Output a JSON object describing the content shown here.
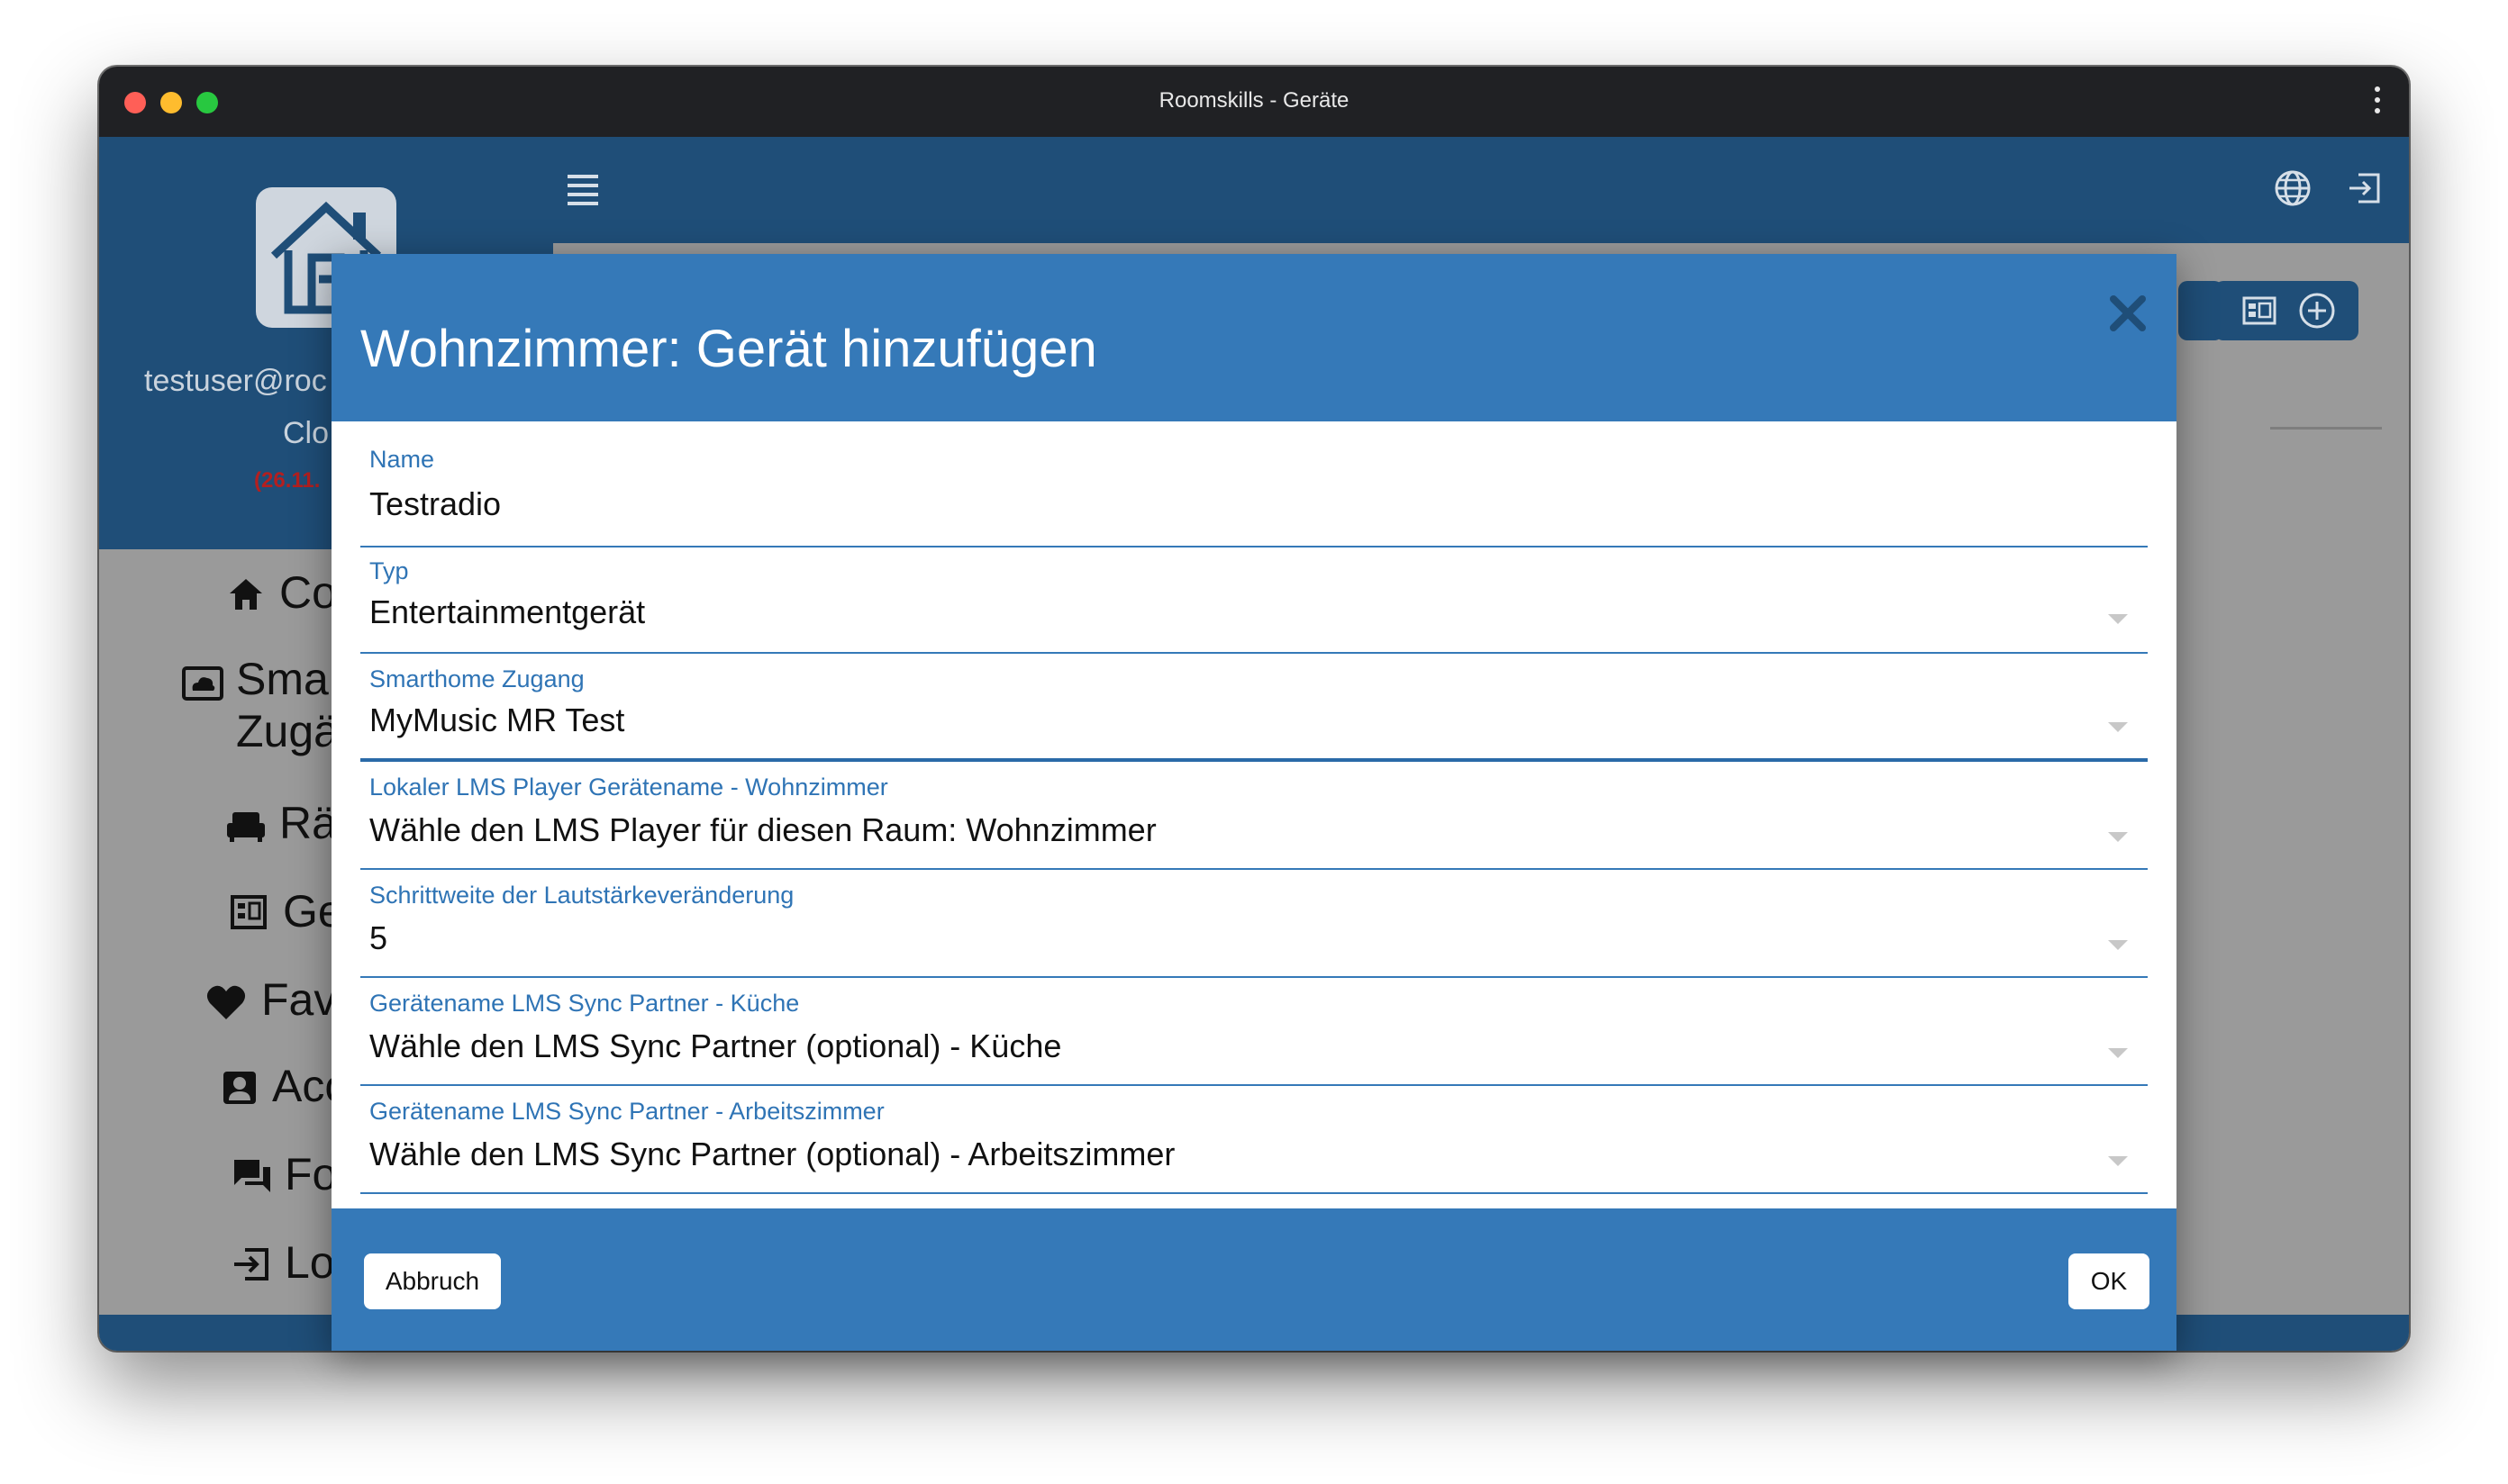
{
  "window": {
    "title": "Roomskills - Geräte"
  },
  "sidebar": {
    "user_email": "testuser@roc",
    "user_cloud": "Clo",
    "user_date": "(26.11.",
    "items": [
      {
        "label": "Co",
        "icon": "home-icon"
      },
      {
        "label": "Sma",
        "label2": "Zugä",
        "icon": "cloud-icon"
      },
      {
        "label": "Rä",
        "icon": "sofa-icon"
      },
      {
        "label": "Ge",
        "icon": "devices-icon"
      },
      {
        "label": "Fav",
        "icon": "heart-icon"
      },
      {
        "label": "Acc",
        "icon": "account-icon"
      },
      {
        "label": "Fo",
        "icon": "forum-icon"
      },
      {
        "label": "Lo",
        "icon": "logout-icon"
      }
    ]
  },
  "modal": {
    "title": "Wohnzimmer: Gerät hinzufügen",
    "fields": [
      {
        "label": "Name",
        "value": "Testradio"
      },
      {
        "label": "Typ",
        "value": "Entertainmentgerät"
      },
      {
        "label": "Smarthome Zugang",
        "value": "MyMusic MR Test"
      },
      {
        "label": "Lokaler LMS Player Gerätename - Wohnzimmer",
        "value": "Wähle den LMS Player für diesen Raum: Wohnzimmer"
      },
      {
        "label": "Schrittweite der Lautstärkeveränderung",
        "value": "5"
      },
      {
        "label": "Gerätename LMS Sync Partner - Küche",
        "value": "Wähle den LMS Sync Partner (optional) - Küche"
      },
      {
        "label": "Gerätename LMS Sync Partner - Arbeitszimmer",
        "value": "Wähle den LMS Sync Partner (optional) - Arbeitszimmer"
      }
    ],
    "cancel_label": "Abbruch",
    "ok_label": "OK"
  },
  "colors": {
    "header_blue": "#1f4e78",
    "modal_blue": "#3579b8",
    "label_blue": "#2f74b5",
    "backdrop_gray": "#9a9a9a"
  }
}
